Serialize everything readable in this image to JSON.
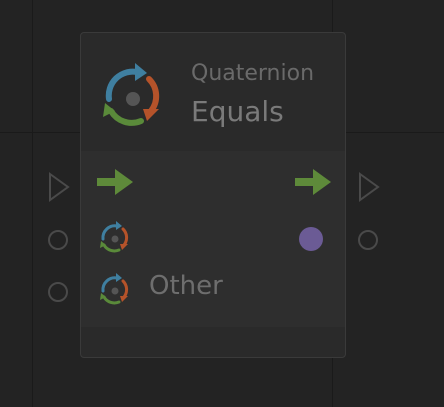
{
  "node": {
    "subtitle": "Quaternion",
    "title": "Equals",
    "icon": "quaternion-cycle-icon"
  },
  "ports": {
    "flow_in_icon": "triangle-outline-icon",
    "flow_out_icon": "triangle-outline-icon",
    "input_a_icon": "quaternion-cycle-icon",
    "input_b_label": "Other",
    "input_b_icon": "quaternion-cycle-icon",
    "output_value_color": "#6b5b95"
  },
  "colors": {
    "background": "#232323",
    "node_body": "#2e2e2e",
    "flow_arrow": "#5e8a3a",
    "cycle_blue": "#3f7fa0",
    "cycle_orange": "#b5532a",
    "cycle_green": "#5a8a3a",
    "output_dot": "#6b5b95"
  }
}
